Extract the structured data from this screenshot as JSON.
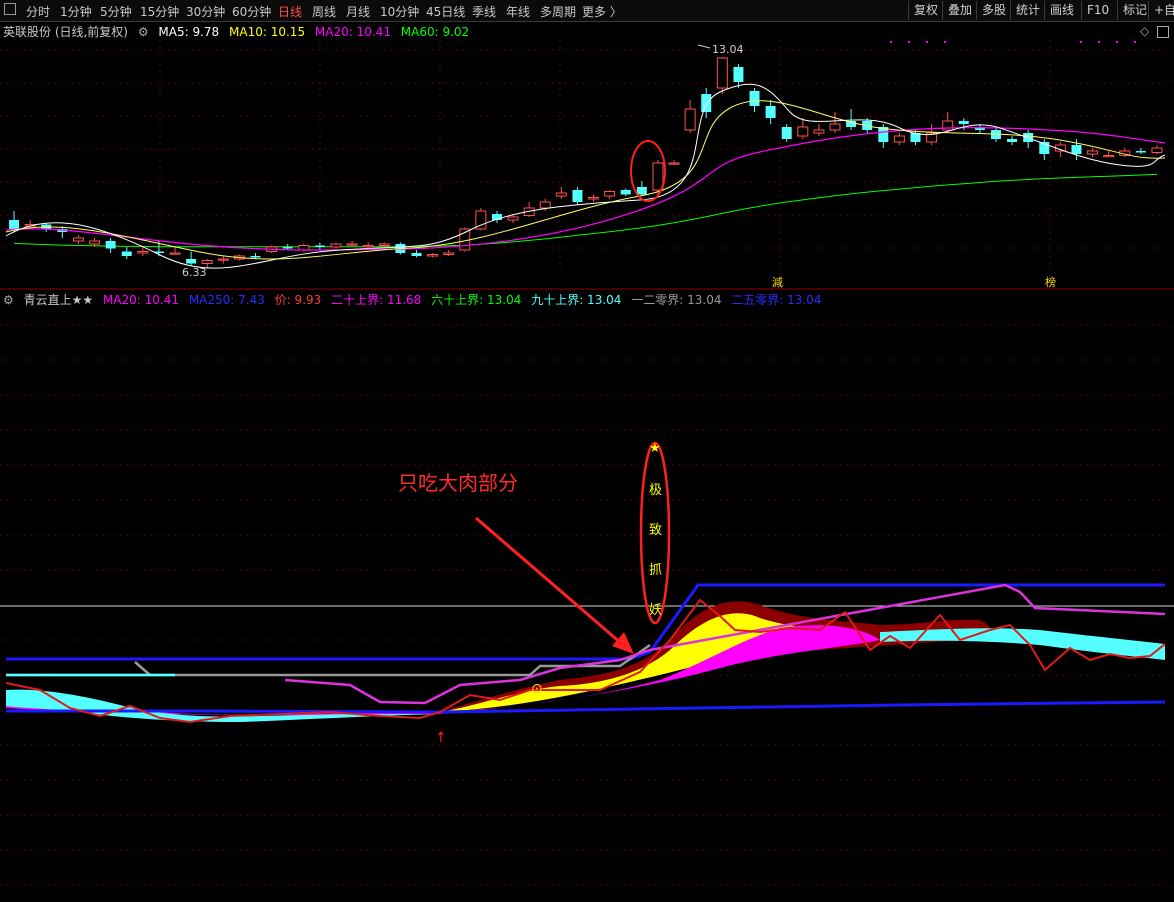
{
  "toolbar": {
    "panel_icon": "panel-toggle-icon",
    "periods": [
      "分时",
      "1分钟",
      "5分钟",
      "15分钟",
      "30分钟",
      "60分钟",
      "日线",
      "周线",
      "月线",
      "10分钟",
      "45日线",
      "季线",
      "年线",
      "多周期",
      "更多 〉"
    ],
    "active_period": "日线",
    "right_buttons": [
      "复权",
      "叠加",
      "多股",
      "统计",
      "画线",
      "F10",
      "标记",
      "+自"
    ]
  },
  "main_legend": {
    "stock": "英联股份 (日线,前复权)",
    "ma5": "MA5: 9.78",
    "ma10": "MA10: 10.15",
    "ma20": "MA20: 10.41",
    "ma60": "MA60: 9.02"
  },
  "sub_legend": {
    "name": "青云直上★★",
    "ma20": "MA20: 10.41",
    "ma250": "MA250: 7.43",
    "price": "价: 9.93",
    "b20": "二十上界: 11.68",
    "b60": "六十上界: 13.04",
    "b90": "九十上界: 13.04",
    "b120": "一二零界: 13.04",
    "b250": "二五零界: 13.04"
  },
  "colors": {
    "ma5": "#ffffff",
    "ma10": "#ffff00",
    "ma20": "#ff00ff",
    "ma60": "#00ff00",
    "up": "#ff5050",
    "down": "#54ffff",
    "annotation": "#ff3b3b",
    "blue": "#1a1aff"
  },
  "annotations": {
    "main_text": "只吃大肉部分",
    "vertical_chars": [
      "★",
      "极",
      "致",
      "抓",
      "妖"
    ],
    "high_label": "13.04",
    "low_label": "6.33",
    "marker1": "減",
    "marker2": "榜"
  },
  "chart_data": {
    "type": "candlestick",
    "y_range": [
      5.6,
      13.6
    ],
    "x_count": 72,
    "candles": [
      [
        7.6,
        7.3,
        7.9,
        7.2
      ],
      [
        7.4,
        7.45,
        7.6,
        7.3
      ],
      [
        7.45,
        7.3,
        7.5,
        7.2
      ],
      [
        7.3,
        7.2,
        7.4,
        7.0
      ],
      [
        6.9,
        7.0,
        7.1,
        6.8
      ],
      [
        6.8,
        6.9,
        7.0,
        6.7
      ],
      [
        6.9,
        6.65,
        7.0,
        6.5
      ],
      [
        6.55,
        6.4,
        6.7,
        6.3
      ],
      [
        6.5,
        6.55,
        6.7,
        6.4
      ],
      [
        6.55,
        6.5,
        6.9,
        6.4
      ],
      [
        6.5,
        6.5,
        6.7,
        6.45
      ],
      [
        6.3,
        6.15,
        6.55,
        6.1
      ],
      [
        6.15,
        6.25,
        6.3,
        6.0
      ],
      [
        6.3,
        6.3,
        6.4,
        6.15
      ],
      [
        6.3,
        6.4,
        6.45,
        6.25
      ],
      [
        6.4,
        6.35,
        6.5,
        6.3
      ],
      [
        6.55,
        6.7,
        6.75,
        6.5
      ],
      [
        6.7,
        6.65,
        6.8,
        6.6
      ],
      [
        6.6,
        6.75,
        6.8,
        6.55
      ],
      [
        6.75,
        6.7,
        6.85,
        6.6
      ],
      [
        6.7,
        6.8,
        6.85,
        6.65
      ],
      [
        6.8,
        6.8,
        6.9,
        6.7
      ],
      [
        6.75,
        6.75,
        6.85,
        6.65
      ],
      [
        6.75,
        6.8,
        6.85,
        6.7
      ],
      [
        6.8,
        6.5,
        6.85,
        6.45
      ],
      [
        6.5,
        6.4,
        6.6,
        6.35
      ],
      [
        6.4,
        6.45,
        6.5,
        6.35
      ],
      [
        6.45,
        6.5,
        6.6,
        6.4
      ],
      [
        6.6,
        7.3,
        7.35,
        6.55
      ],
      [
        7.3,
        7.9,
        8.0,
        7.25
      ],
      [
        7.8,
        7.6,
        7.9,
        7.5
      ],
      [
        7.6,
        7.7,
        7.8,
        7.5
      ],
      [
        7.75,
        8.0,
        8.2,
        7.7
      ],
      [
        8.0,
        8.2,
        8.3,
        7.9
      ],
      [
        8.4,
        8.5,
        8.7,
        8.3
      ],
      [
        8.6,
        8.2,
        8.7,
        8.1
      ],
      [
        8.3,
        8.35,
        8.45,
        8.2
      ],
      [
        8.4,
        8.55,
        8.6,
        8.3
      ],
      [
        8.6,
        8.45,
        8.65,
        8.4
      ],
      [
        8.7,
        8.45,
        8.9,
        8.4
      ],
      [
        8.6,
        9.5,
        9.6,
        8.5
      ],
      [
        9.5,
        9.5,
        9.6,
        9.45
      ],
      [
        10.6,
        11.3,
        11.6,
        10.5
      ],
      [
        11.8,
        11.2,
        12.0,
        11.0
      ],
      [
        12.0,
        13.0,
        13.04,
        11.8
      ],
      [
        12.7,
        12.2,
        12.8,
        12.0
      ],
      [
        11.9,
        11.4,
        12.0,
        11.2
      ],
      [
        11.4,
        11.0,
        11.6,
        10.8
      ],
      [
        10.7,
        10.3,
        10.8,
        10.2
      ],
      [
        10.4,
        10.7,
        11.0,
        10.3
      ],
      [
        10.5,
        10.6,
        10.8,
        10.4
      ],
      [
        10.6,
        10.8,
        11.2,
        10.5
      ],
      [
        10.9,
        10.7,
        11.3,
        10.6
      ],
      [
        10.9,
        10.6,
        11.0,
        10.5
      ],
      [
        10.7,
        10.2,
        10.8,
        10.0
      ],
      [
        10.2,
        10.4,
        10.5,
        10.1
      ],
      [
        10.5,
        10.2,
        10.6,
        10.1
      ],
      [
        10.2,
        10.5,
        10.8,
        10.1
      ],
      [
        10.6,
        10.9,
        11.2,
        10.5
      ],
      [
        10.9,
        10.8,
        11.0,
        10.6
      ],
      [
        10.7,
        10.6,
        10.8,
        10.5
      ],
      [
        10.6,
        10.3,
        10.7,
        10.2
      ],
      [
        10.3,
        10.2,
        10.4,
        10.1
      ],
      [
        10.5,
        10.2,
        10.6,
        10.0
      ],
      [
        10.2,
        9.8,
        10.3,
        9.6
      ],
      [
        9.9,
        10.1,
        10.2,
        9.7
      ],
      [
        10.1,
        9.8,
        10.3,
        9.6
      ],
      [
        9.8,
        9.9,
        10.0,
        9.7
      ],
      [
        9.75,
        9.75,
        9.9,
        9.7
      ],
      [
        9.75,
        9.9,
        10.0,
        9.7
      ],
      [
        9.9,
        9.85,
        10.0,
        9.8
      ],
      [
        9.85,
        10.0,
        10.1,
        9.8
      ]
    ],
    "ma60": [
      6.82,
      6.8,
      6.78,
      6.76,
      6.75,
      6.74,
      6.73,
      6.72,
      6.72,
      6.71,
      6.71,
      6.71,
      6.71,
      6.71,
      6.71,
      6.71,
      6.71,
      6.71,
      6.71,
      6.71,
      6.71,
      6.71,
      6.71,
      6.71,
      6.71,
      6.72,
      6.73,
      6.74,
      6.76,
      6.79,
      6.83,
      6.87,
      6.92,
      6.97,
      7.03,
      7.09,
      7.15,
      7.21,
      7.27,
      7.34,
      7.42,
      7.51,
      7.61,
      7.71,
      7.82,
      7.93,
      8.03,
      8.12,
      8.2,
      8.27,
      8.34,
      8.41,
      8.47,
      8.53,
      8.58,
      8.63,
      8.68,
      8.73,
      8.77,
      8.81,
      8.85,
      8.89,
      8.92,
      8.95,
      8.98,
      9.0,
      9.02,
      9.04,
      9.06,
      9.08,
      9.1,
      9.12
    ]
  }
}
